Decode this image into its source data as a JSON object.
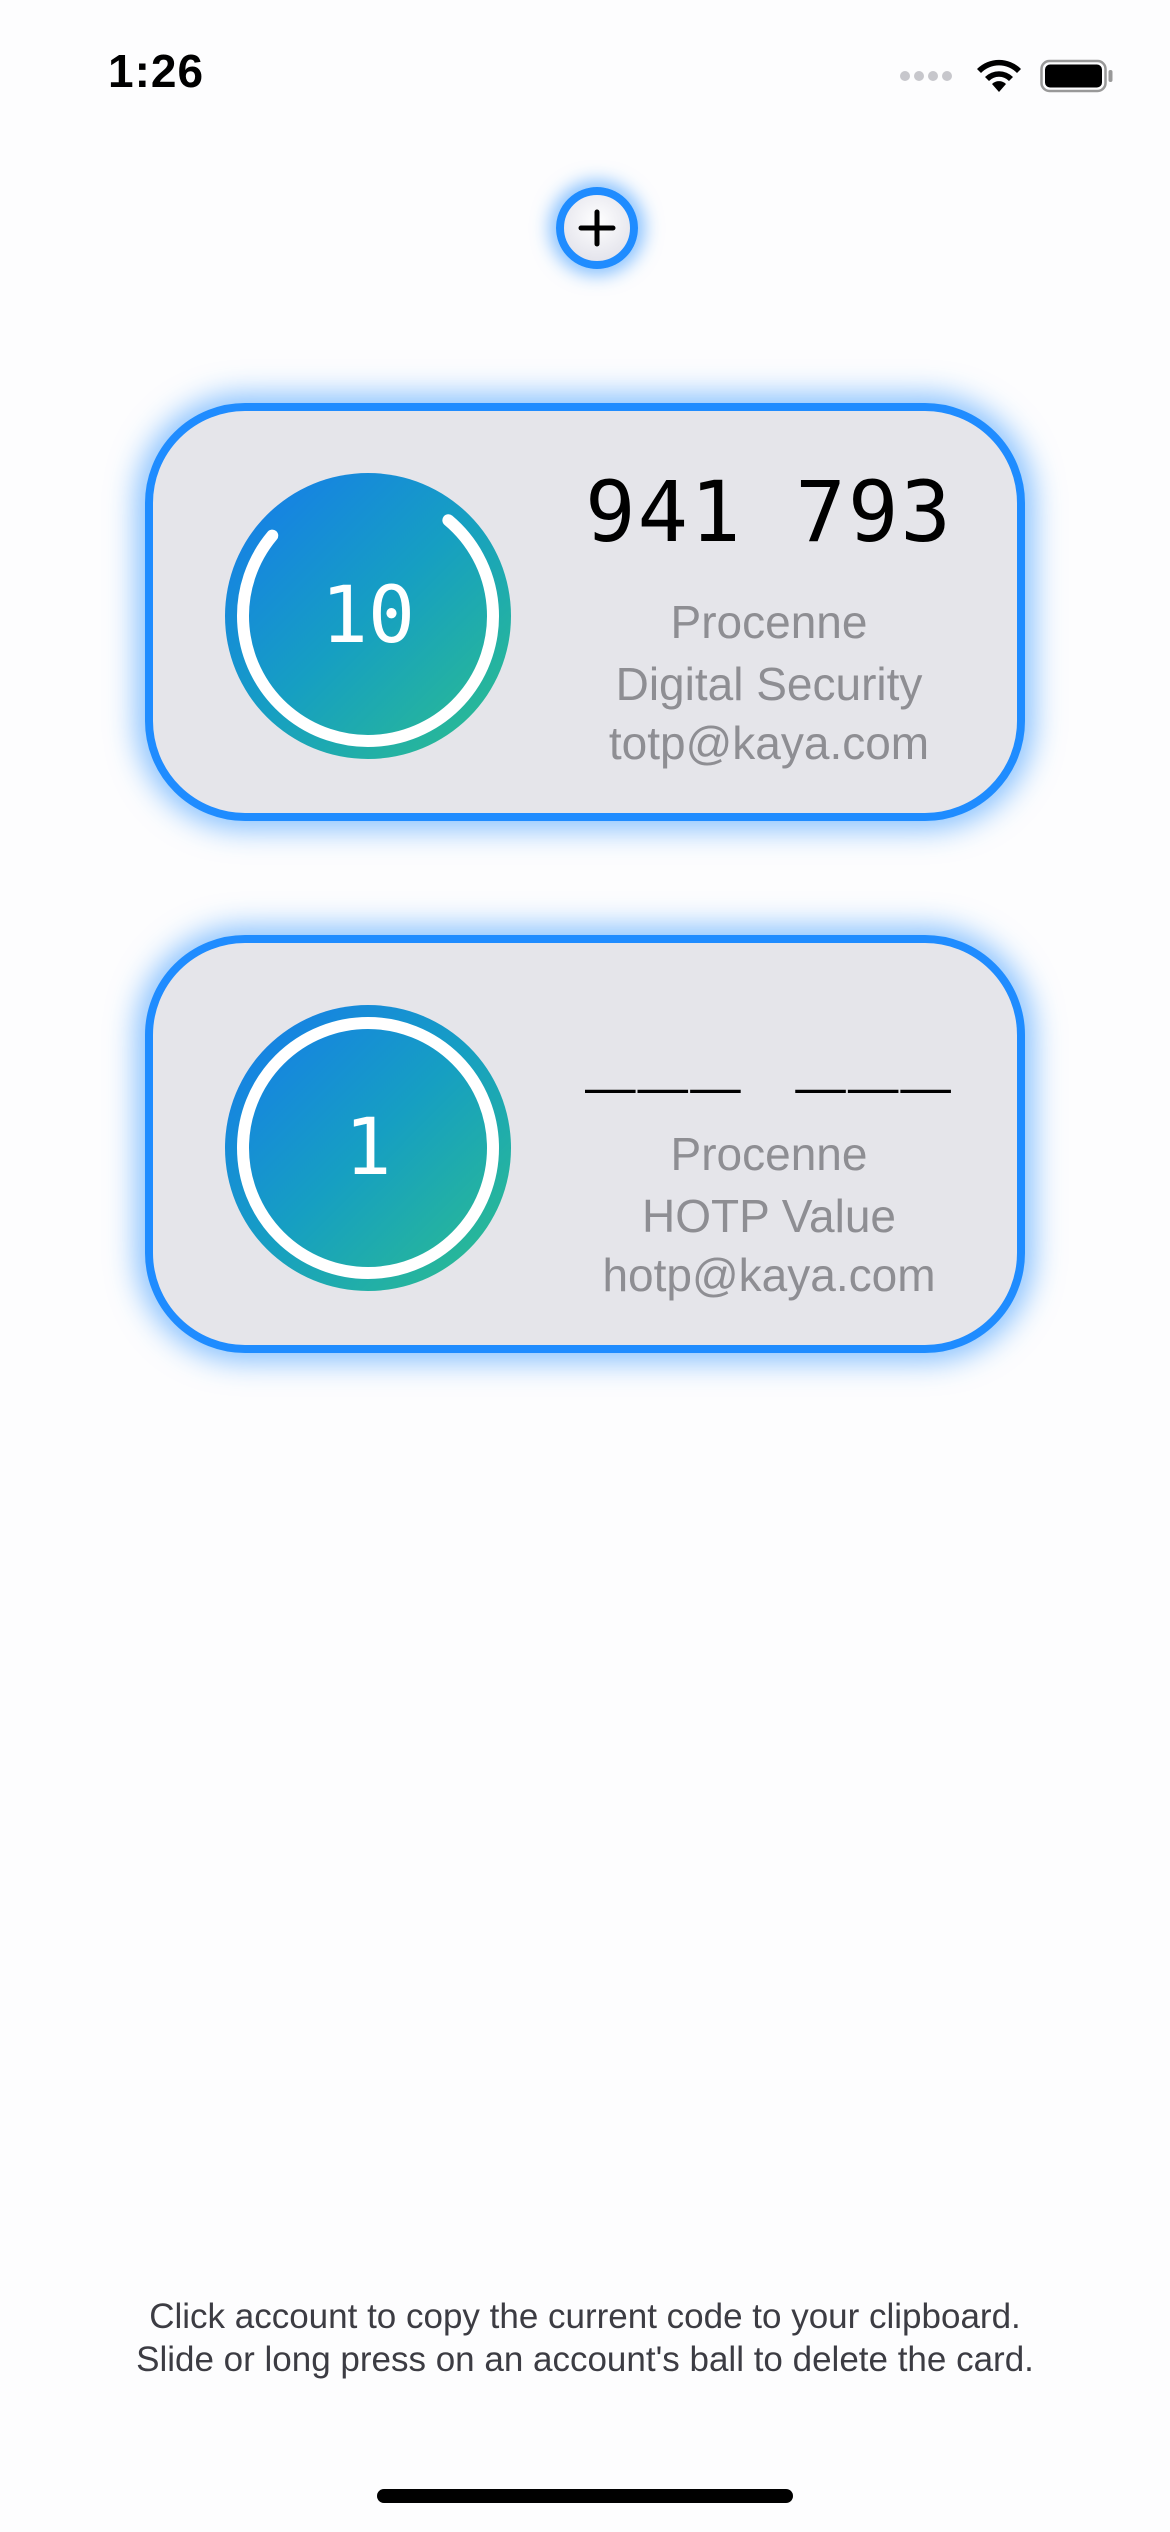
{
  "status_bar": {
    "time": "1:26",
    "icons": [
      "cellular-signal-icon",
      "wifi-icon",
      "battery-icon"
    ]
  },
  "add_button": {
    "icon": "plus-icon"
  },
  "accounts": [
    {
      "ball_counter": "10",
      "code": "941 793",
      "issuer": "Procenne",
      "name": "Digital Security",
      "email": "totp@kaya.com",
      "ring_progress": 0.75
    },
    {
      "ball_counter": "1",
      "code": "___ ___",
      "issuer": "Procenne",
      "name": "HOTP Value",
      "email": "hotp@kaya.com",
      "ring_progress": 1.0
    }
  ],
  "instructions": {
    "line1": "Click account to copy the current code to your clipboard.",
    "line2": "Slide or long press on an account's ball to delete the card."
  },
  "colors": {
    "accent": "#1f8cff",
    "card_background": "#e5e5ea",
    "ball_gradient_start": "#1679ee",
    "ball_gradient_end": "#2ec08a",
    "secondary_text": "#8e8e93"
  }
}
